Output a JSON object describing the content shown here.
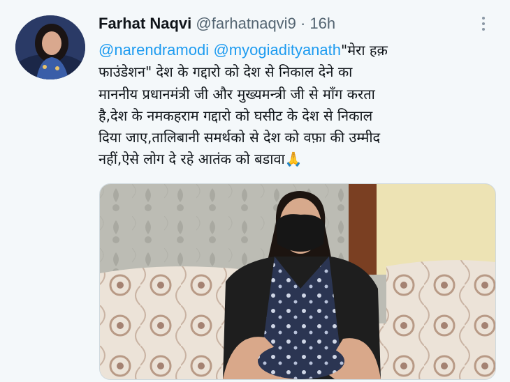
{
  "tweet": {
    "author_name": "Farhat Naqvi",
    "author_handle": "@farhatnaqvi9",
    "separator": "·",
    "time": "16h",
    "mention_1": "@narendramodi",
    "mention_2": "@myogiadityanath",
    "line1_rest": "\"मेरा हक़",
    "line2": "फाउंडेशन\" देश के गद्दारो को देश से निकाल देने का",
    "line3": "माननीय प्रधानमंत्री जी और मुख्यमन्त्री जी से माँग करता",
    "line4": "है,देश के नमकहराम गद्दारो को घसीट के देश से निकाल",
    "line5": "दिया जाए,तालिबानी समर्थको से देश को वफ़ा की उम्मीद",
    "line6": "नहीं,ऐसे लोग दे रहे आतंक को बडावा",
    "emoji": "🙏"
  },
  "colors": {
    "accent": "#1d9bf0",
    "text": "#0f1419",
    "secondary": "#536471",
    "background": "#f4f8fa"
  },
  "icons": {
    "more": "more-vertical-icon",
    "emoji": "folded-hands-emoji"
  }
}
